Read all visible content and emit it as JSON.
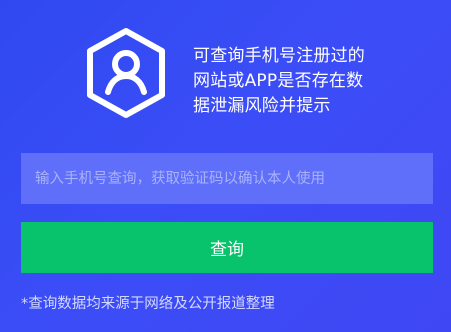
{
  "hero": {
    "icon": "user-hexagon-icon",
    "description_lines": [
      "可查询手机号注册过的",
      "网站或APP是否存在数",
      "据泄漏风险并提示"
    ]
  },
  "form": {
    "phone_placeholder": "输入手机号查询，获取验证码以确认本人使用",
    "phone_value": "",
    "submit_label": "查询"
  },
  "footnote": "*查询数据均来源于网络及公开报道整理",
  "colors": {
    "background": "#3b4df6",
    "input_background": "#5f6ffa",
    "button_background": "#08c36c",
    "text": "#ffffff"
  }
}
